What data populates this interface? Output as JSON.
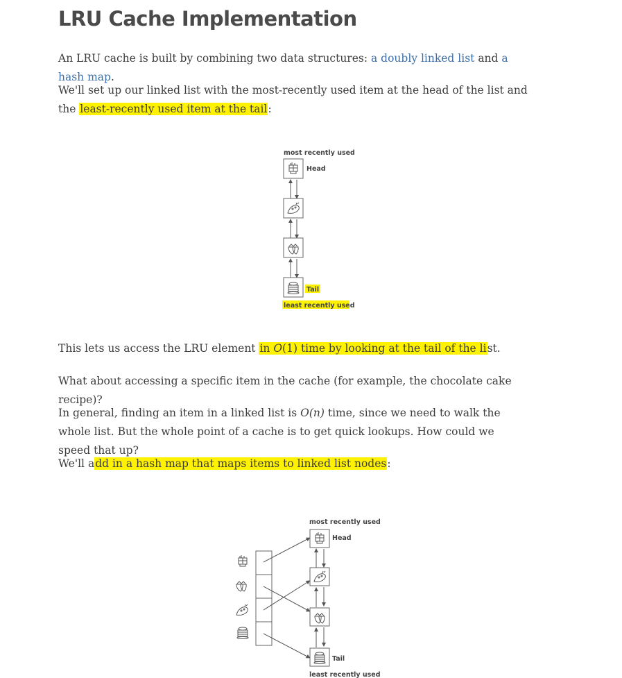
{
  "title": "LRU Cache Implementation",
  "p1": {
    "before": "An LRU cache is built by combining two data structures: ",
    "link1": "a doubly linked list",
    "mid": " and ",
    "link2": "a hash map",
    "after": "."
  },
  "p2": {
    "before": "We'll set up our linked list with the most-recently used item at the head of the list and the ",
    "highlight": "least-recently used item at the tail",
    "after": ":"
  },
  "diagram1": {
    "top_label": "most recently used",
    "head_label": "Head",
    "tail_label": "Tail",
    "bottom_label": "least recently used",
    "icons": [
      "chocolate-cake-icon",
      "cookie-icon",
      "strawberries-icon",
      "pancakes-icon"
    ]
  },
  "p3": {
    "before": "This lets us access the LRU element ",
    "hl_in": "in ",
    "o": "O",
    "one": "(1)",
    "hl_rest": " time by looking at the tail of the li",
    "after": "st."
  },
  "p4": "What about accessing a specific item in the cache (for example, the chocolate cake recipe)?",
  "p5": {
    "before": "In general, finding an item in a linked list is ",
    "o": "O",
    "n": "(n)",
    "after": " time, since we need to walk the whole list. But the whole point of a cache is to get quick lookups. How could we speed that up?"
  },
  "p6": {
    "before": "We'll a",
    "highlight": "dd in a hash map that maps items to linked list nodes",
    "after": ":"
  },
  "diagram2": {
    "top_label": "most recently used",
    "head_label": "Head",
    "tail_label": "Tail",
    "bottom_label": "least recently used",
    "key_icons": [
      "chocolate-cake-icon",
      "strawberries-icon",
      "cookie-icon",
      "pancakes-icon"
    ],
    "node_icons": [
      "chocolate-cake-icon",
      "cookie-icon",
      "strawberries-icon",
      "pancakes-icon"
    ]
  },
  "colors": {
    "highlight": "#fff200",
    "link": "#3d6fa8",
    "title": "#4a4a4a",
    "diagram": "#555555"
  }
}
